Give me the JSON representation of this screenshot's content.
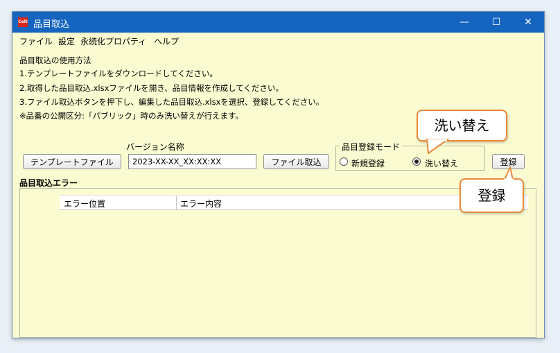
{
  "window": {
    "title": "品目取込",
    "app_icon_text": "Celt",
    "controls": {
      "minimize": "—",
      "maximize": "☐",
      "close": "✕"
    }
  },
  "menu": [
    "ファイル",
    "設定",
    "永続化プロパティ",
    "ヘルプ"
  ],
  "instructions": [
    "品目取込の使用方法",
    "1.テンプレートファイルをダウンロードしてください。",
    "2.取得した品目取込.xlsxファイルを開き、品目情報を作成してください。",
    "3.ファイル取込ボタンを押下し、編集した品目取込.xlsxを選択、登録してください。",
    "※品番の公開区分:「パブリック」時のみ洗い替えが行えます。"
  ],
  "toolbar": {
    "template_button": "テンプレートファイル",
    "version_label": "バージョン名称",
    "version_value": "2023-XX-XX_XX:XX:XX",
    "import_button": "ファイル取込",
    "mode_group_label": "品目登録モード",
    "mode_options": [
      "新規登録",
      "洗い替え"
    ],
    "mode_selected": "洗い替え",
    "register_button": "登録"
  },
  "errors": {
    "title": "品目取込エラー",
    "columns": [
      "エラー位置",
      "エラー内容"
    ]
  },
  "callouts": {
    "replace": "洗い替え",
    "register": "登録"
  },
  "colors": {
    "titlebar": "#1565c0",
    "window_bg": "#fafbd0",
    "callout_border": "#e8893a"
  }
}
